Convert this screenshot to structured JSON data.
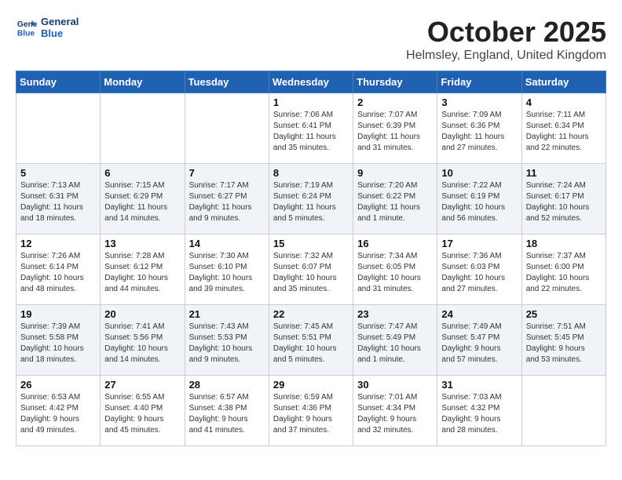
{
  "header": {
    "logo_line1": "General",
    "logo_line2": "Blue",
    "month": "October 2025",
    "location": "Helmsley, England, United Kingdom"
  },
  "weekdays": [
    "Sunday",
    "Monday",
    "Tuesday",
    "Wednesday",
    "Thursday",
    "Friday",
    "Saturday"
  ],
  "weeks": [
    [
      {
        "day": "",
        "info": ""
      },
      {
        "day": "",
        "info": ""
      },
      {
        "day": "",
        "info": ""
      },
      {
        "day": "1",
        "info": "Sunrise: 7:06 AM\nSunset: 6:41 PM\nDaylight: 11 hours\nand 35 minutes."
      },
      {
        "day": "2",
        "info": "Sunrise: 7:07 AM\nSunset: 6:39 PM\nDaylight: 11 hours\nand 31 minutes."
      },
      {
        "day": "3",
        "info": "Sunrise: 7:09 AM\nSunset: 6:36 PM\nDaylight: 11 hours\nand 27 minutes."
      },
      {
        "day": "4",
        "info": "Sunrise: 7:11 AM\nSunset: 6:34 PM\nDaylight: 11 hours\nand 22 minutes."
      }
    ],
    [
      {
        "day": "5",
        "info": "Sunrise: 7:13 AM\nSunset: 6:31 PM\nDaylight: 11 hours\nand 18 minutes."
      },
      {
        "day": "6",
        "info": "Sunrise: 7:15 AM\nSunset: 6:29 PM\nDaylight: 11 hours\nand 14 minutes."
      },
      {
        "day": "7",
        "info": "Sunrise: 7:17 AM\nSunset: 6:27 PM\nDaylight: 11 hours\nand 9 minutes."
      },
      {
        "day": "8",
        "info": "Sunrise: 7:19 AM\nSunset: 6:24 PM\nDaylight: 11 hours\nand 5 minutes."
      },
      {
        "day": "9",
        "info": "Sunrise: 7:20 AM\nSunset: 6:22 PM\nDaylight: 11 hours\nand 1 minute."
      },
      {
        "day": "10",
        "info": "Sunrise: 7:22 AM\nSunset: 6:19 PM\nDaylight: 10 hours\nand 56 minutes."
      },
      {
        "day": "11",
        "info": "Sunrise: 7:24 AM\nSunset: 6:17 PM\nDaylight: 10 hours\nand 52 minutes."
      }
    ],
    [
      {
        "day": "12",
        "info": "Sunrise: 7:26 AM\nSunset: 6:14 PM\nDaylight: 10 hours\nand 48 minutes."
      },
      {
        "day": "13",
        "info": "Sunrise: 7:28 AM\nSunset: 6:12 PM\nDaylight: 10 hours\nand 44 minutes."
      },
      {
        "day": "14",
        "info": "Sunrise: 7:30 AM\nSunset: 6:10 PM\nDaylight: 10 hours\nand 39 minutes."
      },
      {
        "day": "15",
        "info": "Sunrise: 7:32 AM\nSunset: 6:07 PM\nDaylight: 10 hours\nand 35 minutes."
      },
      {
        "day": "16",
        "info": "Sunrise: 7:34 AM\nSunset: 6:05 PM\nDaylight: 10 hours\nand 31 minutes."
      },
      {
        "day": "17",
        "info": "Sunrise: 7:36 AM\nSunset: 6:03 PM\nDaylight: 10 hours\nand 27 minutes."
      },
      {
        "day": "18",
        "info": "Sunrise: 7:37 AM\nSunset: 6:00 PM\nDaylight: 10 hours\nand 22 minutes."
      }
    ],
    [
      {
        "day": "19",
        "info": "Sunrise: 7:39 AM\nSunset: 5:58 PM\nDaylight: 10 hours\nand 18 minutes."
      },
      {
        "day": "20",
        "info": "Sunrise: 7:41 AM\nSunset: 5:56 PM\nDaylight: 10 hours\nand 14 minutes."
      },
      {
        "day": "21",
        "info": "Sunrise: 7:43 AM\nSunset: 5:53 PM\nDaylight: 10 hours\nand 9 minutes."
      },
      {
        "day": "22",
        "info": "Sunrise: 7:45 AM\nSunset: 5:51 PM\nDaylight: 10 hours\nand 5 minutes."
      },
      {
        "day": "23",
        "info": "Sunrise: 7:47 AM\nSunset: 5:49 PM\nDaylight: 10 hours\nand 1 minute."
      },
      {
        "day": "24",
        "info": "Sunrise: 7:49 AM\nSunset: 5:47 PM\nDaylight: 9 hours\nand 57 minutes."
      },
      {
        "day": "25",
        "info": "Sunrise: 7:51 AM\nSunset: 5:45 PM\nDaylight: 9 hours\nand 53 minutes."
      }
    ],
    [
      {
        "day": "26",
        "info": "Sunrise: 6:53 AM\nSunset: 4:42 PM\nDaylight: 9 hours\nand 49 minutes."
      },
      {
        "day": "27",
        "info": "Sunrise: 6:55 AM\nSunset: 4:40 PM\nDaylight: 9 hours\nand 45 minutes."
      },
      {
        "day": "28",
        "info": "Sunrise: 6:57 AM\nSunset: 4:38 PM\nDaylight: 9 hours\nand 41 minutes."
      },
      {
        "day": "29",
        "info": "Sunrise: 6:59 AM\nSunset: 4:36 PM\nDaylight: 9 hours\nand 37 minutes."
      },
      {
        "day": "30",
        "info": "Sunrise: 7:01 AM\nSunset: 4:34 PM\nDaylight: 9 hours\nand 32 minutes."
      },
      {
        "day": "31",
        "info": "Sunrise: 7:03 AM\nSunset: 4:32 PM\nDaylight: 9 hours\nand 28 minutes."
      },
      {
        "day": "",
        "info": ""
      }
    ]
  ]
}
